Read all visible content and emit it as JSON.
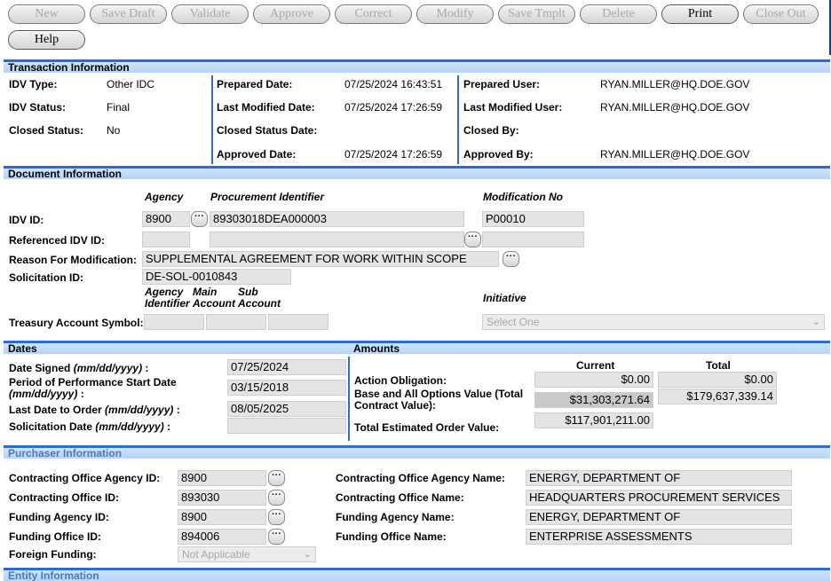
{
  "toolbar": {
    "new": "New",
    "save_draft": "Save Draft",
    "validate": "Validate",
    "approve": "Approve",
    "correct": "Correct",
    "modify": "Modify",
    "save_tmplt": "Save Tmplt",
    "delete": "Delete",
    "print": "Print",
    "close_out": "Close Out",
    "help": "Help"
  },
  "transaction": {
    "header": "Transaction Information",
    "idv_type_label": "IDV Type:",
    "idv_type": "Other IDC",
    "idv_status_label": "IDV Status:",
    "idv_status": "Final",
    "closed_status_label": "Closed Status:",
    "closed_status": "No",
    "prepared_date_label": "Prepared Date:",
    "prepared_date": "07/25/2024 16:43:51",
    "last_modified_date_label": "Last Modified Date:",
    "last_modified_date": "07/25/2024 17:26:59",
    "closed_status_date_label": "Closed Status Date:",
    "approved_date_label": "Approved Date:",
    "approved_date": "07/25/2024 17:26:59",
    "prepared_user_label": "Prepared User:",
    "prepared_user": "RYAN.MILLER@HQ.DOE.GOV",
    "last_modified_user_label": "Last Modified User:",
    "last_modified_user": "RYAN.MILLER@HQ.DOE.GOV",
    "closed_by_label": "Closed By:",
    "approved_by_label": "Approved By:",
    "approved_by": "RYAN.MILLER@HQ.DOE.GOV"
  },
  "document": {
    "header": "Document Information",
    "col_agency": "Agency",
    "col_procurement_identifier": "Procurement Identifier",
    "col_modification_no": "Modification No",
    "idv_id_label": "IDV ID:",
    "idv_agency": "8900",
    "idv_procurement_id": "89303018DEA000003",
    "idv_modification_no": "P00010",
    "referenced_idv_label": "Referenced IDV ID:",
    "reason_label": "Reason For Modification:",
    "reason": "SUPPLEMENTAL AGREEMENT FOR WORK WITHIN SCOPE",
    "solicitation_label": "Solicitation ID:",
    "solicitation": "DE-SOL-0010843",
    "col_agency_identifier_1": "Agency",
    "col_agency_identifier_2": "Identifier",
    "col_main_account_1": "Main",
    "col_main_account_2": "Account",
    "col_sub_account_1": "Sub",
    "col_sub_account_2": "Account",
    "col_initiative": "Initiative",
    "treasury_label": "Treasury Account Symbol:",
    "initiative_placeholder": "Select One"
  },
  "dates": {
    "header": "Dates",
    "date_signed_label": "Date Signed",
    "date_signed_fmt": "(mm/dd/yyyy)",
    "date_signed_colon": " :",
    "date_signed": "07/25/2024",
    "pop_start_label": "Period of Performance Start Date",
    "pop_start_fmt": "(mm/dd/yyyy)",
    "pop_start_colon": " :",
    "pop_start": "03/15/2018",
    "last_date_order_label": "Last Date to Order",
    "last_date_order_fmt": "(mm/dd/yyyy)",
    "last_date_order_colon": " :",
    "last_date_order": "08/05/2025",
    "solicitation_date_label": "Solicitation Date",
    "solicitation_date_fmt": "(mm/dd/yyyy)",
    "solicitation_date_colon": " :"
  },
  "amounts": {
    "header": "Amounts",
    "col_current": "Current",
    "col_total": "Total",
    "action_obligation_label": "Action Obligation:",
    "action_obligation_current": "$0.00",
    "action_obligation_total": "$0.00",
    "base_options_label_1": "Base and All Options Value (Total",
    "base_options_label_2": "Contract Value):",
    "base_options_current": "$31,303,271.64",
    "base_options_total": "$179,637,339.14",
    "total_estimated_label": "Total Estimated Order Value:",
    "total_estimated_current": "$117,901,211.00"
  },
  "purchaser": {
    "header": "Purchaser Information",
    "co_agency_id_label": "Contracting Office Agency ID:",
    "co_agency_id": "8900",
    "co_id_label": "Contracting Office ID:",
    "co_id": "893030",
    "funding_agency_id_label": "Funding Agency ID:",
    "funding_agency_id": "8900",
    "funding_office_id_label": "Funding Office ID:",
    "funding_office_id": "894006",
    "foreign_funding_label": "Foreign Funding:",
    "foreign_funding": "Not Applicable",
    "co_agency_name_label": "Contracting Office Agency Name:",
    "co_agency_name": "ENERGY, DEPARTMENT OF",
    "co_name_label": "Contracting Office Name:",
    "co_name": "HEADQUARTERS PROCUREMENT SERVICES",
    "funding_agency_name_label": "Funding Agency Name:",
    "funding_agency_name": "ENERGY, DEPARTMENT OF",
    "funding_office_name_label": "Funding Office Name:",
    "funding_office_name": "ENTERPRISE ASSESSMENTS"
  },
  "entity": {
    "header": "Entity Information"
  },
  "icons": {
    "lookup": "ellipsis-lookup-icon",
    "dropdown": "chevron-down-icon"
  },
  "colors": {
    "section_bar": "#2d6ad1",
    "section_header_bg": "#c4dbf8",
    "field_bg": "#e4e4e4"
  }
}
